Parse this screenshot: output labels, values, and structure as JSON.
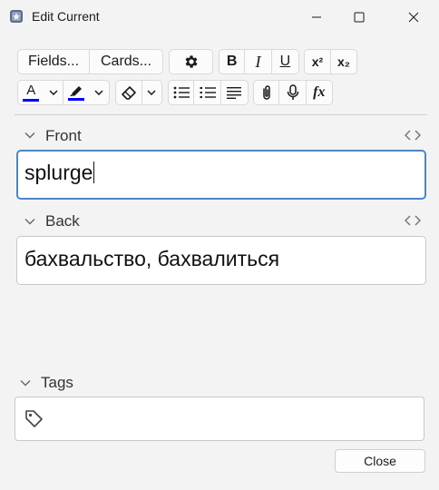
{
  "window": {
    "title": "Edit Current",
    "app_icon": "anki-app-icon",
    "controls": [
      "minimize-icon",
      "maximize-icon",
      "close-icon"
    ]
  },
  "toolbar": {
    "fields_label": "Fields...",
    "cards_label": "Cards...",
    "bold": "B",
    "italic": "I",
    "underline": "U",
    "superscript": "x²",
    "subscript": "x₂",
    "text_color": "A",
    "mathjax": "fx",
    "text_color_value": "#0000ff",
    "highlight_color_value": "#0000ff",
    "icons": [
      "gear-icon",
      "eraser-icon",
      "unordered-list-icon",
      "ordered-list-icon",
      "align-icon",
      "paperclip-icon",
      "microphone-icon",
      "mathjax-icon"
    ]
  },
  "fields": {
    "front": {
      "label": "Front",
      "value": "splurge"
    },
    "back": {
      "label": "Back",
      "value": "бахвальство, бахвалиться"
    }
  },
  "tags": {
    "label": "Tags",
    "value": ""
  },
  "footer": {
    "close_label": "Close"
  }
}
